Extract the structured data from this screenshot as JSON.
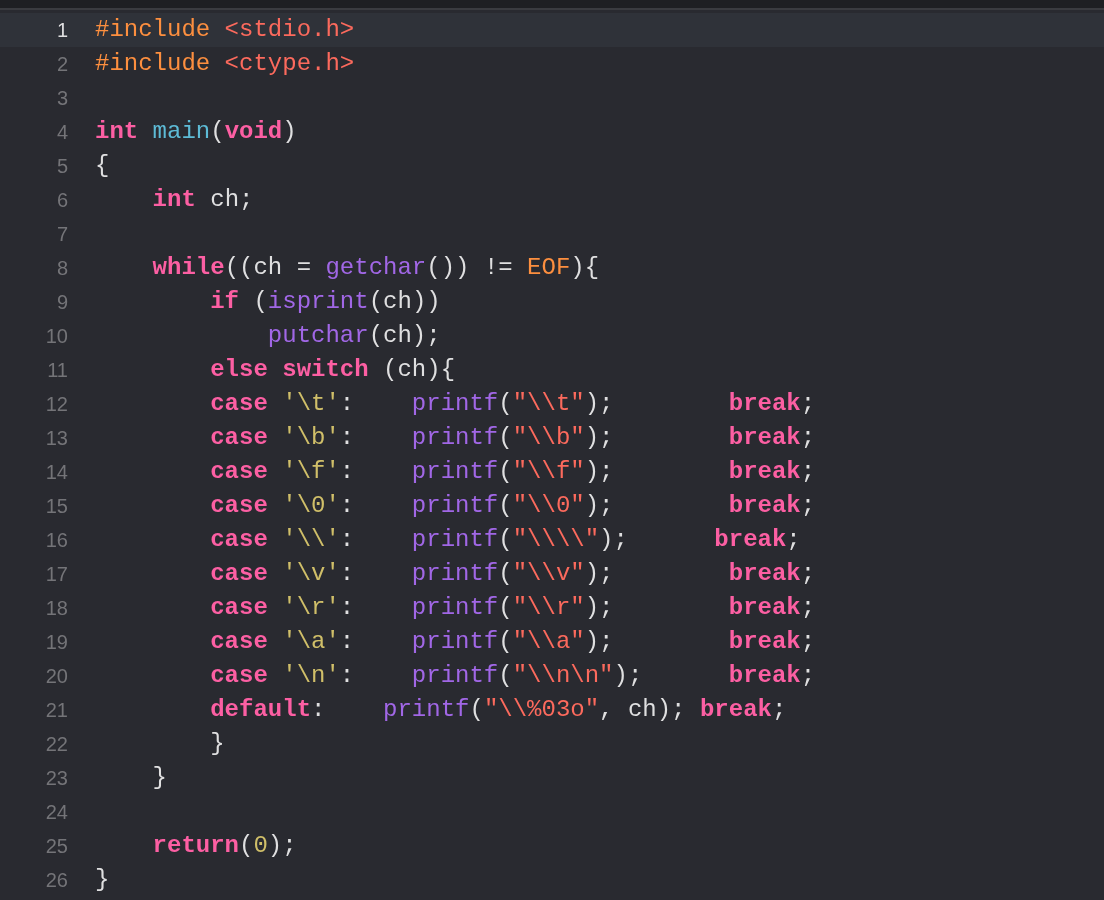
{
  "editor": {
    "lines": [
      {
        "number": "1",
        "current": true,
        "tokens": [
          {
            "text": "#include",
            "kind": "preprocessor"
          },
          {
            "text": " <stdio.h>",
            "kind": "string"
          }
        ]
      },
      {
        "number": "2",
        "current": false,
        "tokens": [
          {
            "text": "#include",
            "kind": "preprocessor"
          },
          {
            "text": " <ctype.h>",
            "kind": "string"
          }
        ]
      },
      {
        "number": "3",
        "current": false
      },
      {
        "number": "4",
        "current": false,
        "tokens": [
          {
            "text": "int",
            "kind": "keyword"
          },
          {
            "text": " main",
            "kind": "declaration"
          },
          {
            "text": "(",
            "kind": "plain"
          },
          {
            "text": "void",
            "kind": "keyword"
          },
          {
            "text": ")",
            "kind": "plain"
          }
        ]
      },
      {
        "number": "5",
        "current": false,
        "tokens": [
          {
            "text": "{",
            "kind": "plain"
          }
        ]
      },
      {
        "number": "6",
        "current": false,
        "tokens": [
          {
            "text": "    int",
            "kind": "keyword"
          },
          {
            "text": " ch;",
            "kind": "plain"
          }
        ]
      },
      {
        "number": "7",
        "current": false
      },
      {
        "number": "8",
        "current": false,
        "tokens": [
          {
            "text": "    while",
            "kind": "keyword"
          },
          {
            "text": "((ch = ",
            "kind": "plain"
          },
          {
            "text": "getchar",
            "kind": "function"
          },
          {
            "text": "()) != ",
            "kind": "plain"
          },
          {
            "text": "EOF",
            "kind": "macro"
          },
          {
            "text": "){",
            "kind": "plain"
          }
        ]
      },
      {
        "number": "9",
        "current": false,
        "tokens": [
          {
            "text": "        if",
            "kind": "keyword"
          },
          {
            "text": " (",
            "kind": "plain"
          },
          {
            "text": "isprint",
            "kind": "function"
          },
          {
            "text": "(ch))",
            "kind": "plain"
          }
        ]
      },
      {
        "number": "10",
        "current": false,
        "tokens": [
          {
            "text": "            putchar",
            "kind": "function"
          },
          {
            "text": "(ch);",
            "kind": "plain"
          }
        ]
      },
      {
        "number": "11",
        "current": false,
        "tokens": [
          {
            "text": "        else",
            "kind": "keyword"
          },
          {
            "text": " switch",
            "kind": "keyword"
          },
          {
            "text": " (ch){",
            "kind": "plain"
          }
        ]
      },
      {
        "number": "12",
        "current": false,
        "tokens": [
          {
            "text": "        case",
            "kind": "keyword"
          },
          {
            "text": " '\\t'",
            "kind": "char"
          },
          {
            "text": ":    ",
            "kind": "plain"
          },
          {
            "text": "printf",
            "kind": "function"
          },
          {
            "text": "(",
            "kind": "plain"
          },
          {
            "text": "\"\\\\t\"",
            "kind": "string"
          },
          {
            "text": ");        ",
            "kind": "plain"
          },
          {
            "text": "break",
            "kind": "keyword"
          },
          {
            "text": ";",
            "kind": "plain"
          }
        ]
      },
      {
        "number": "13",
        "current": false,
        "tokens": [
          {
            "text": "        case",
            "kind": "keyword"
          },
          {
            "text": " '\\b'",
            "kind": "char"
          },
          {
            "text": ":    ",
            "kind": "plain"
          },
          {
            "text": "printf",
            "kind": "function"
          },
          {
            "text": "(",
            "kind": "plain"
          },
          {
            "text": "\"\\\\b\"",
            "kind": "string"
          },
          {
            "text": ");        ",
            "kind": "plain"
          },
          {
            "text": "break",
            "kind": "keyword"
          },
          {
            "text": ";",
            "kind": "plain"
          }
        ]
      },
      {
        "number": "14",
        "current": false,
        "tokens": [
          {
            "text": "        case",
            "kind": "keyword"
          },
          {
            "text": " '\\f'",
            "kind": "char"
          },
          {
            "text": ":    ",
            "kind": "plain"
          },
          {
            "text": "printf",
            "kind": "function"
          },
          {
            "text": "(",
            "kind": "plain"
          },
          {
            "text": "\"\\\\f\"",
            "kind": "string"
          },
          {
            "text": ");        ",
            "kind": "plain"
          },
          {
            "text": "break",
            "kind": "keyword"
          },
          {
            "text": ";",
            "kind": "plain"
          }
        ]
      },
      {
        "number": "15",
        "current": false,
        "tokens": [
          {
            "text": "        case",
            "kind": "keyword"
          },
          {
            "text": " '\\0'",
            "kind": "char"
          },
          {
            "text": ":    ",
            "kind": "plain"
          },
          {
            "text": "printf",
            "kind": "function"
          },
          {
            "text": "(",
            "kind": "plain"
          },
          {
            "text": "\"\\\\0\"",
            "kind": "string"
          },
          {
            "text": ");        ",
            "kind": "plain"
          },
          {
            "text": "break",
            "kind": "keyword"
          },
          {
            "text": ";",
            "kind": "plain"
          }
        ]
      },
      {
        "number": "16",
        "current": false,
        "tokens": [
          {
            "text": "        case",
            "kind": "keyword"
          },
          {
            "text": " '\\\\'",
            "kind": "char"
          },
          {
            "text": ":    ",
            "kind": "plain"
          },
          {
            "text": "printf",
            "kind": "function"
          },
          {
            "text": "(",
            "kind": "plain"
          },
          {
            "text": "\"\\\\\\\\\"",
            "kind": "string"
          },
          {
            "text": ");      ",
            "kind": "plain"
          },
          {
            "text": "break",
            "kind": "keyword"
          },
          {
            "text": ";",
            "kind": "plain"
          }
        ]
      },
      {
        "number": "17",
        "current": false,
        "tokens": [
          {
            "text": "        case",
            "kind": "keyword"
          },
          {
            "text": " '\\v'",
            "kind": "char"
          },
          {
            "text": ":    ",
            "kind": "plain"
          },
          {
            "text": "printf",
            "kind": "function"
          },
          {
            "text": "(",
            "kind": "plain"
          },
          {
            "text": "\"\\\\v\"",
            "kind": "string"
          },
          {
            "text": ");        ",
            "kind": "plain"
          },
          {
            "text": "break",
            "kind": "keyword"
          },
          {
            "text": ";",
            "kind": "plain"
          }
        ]
      },
      {
        "number": "18",
        "current": false,
        "tokens": [
          {
            "text": "        case",
            "kind": "keyword"
          },
          {
            "text": " '\\r'",
            "kind": "char"
          },
          {
            "text": ":    ",
            "kind": "plain"
          },
          {
            "text": "printf",
            "kind": "function"
          },
          {
            "text": "(",
            "kind": "plain"
          },
          {
            "text": "\"\\\\r\"",
            "kind": "string"
          },
          {
            "text": ");        ",
            "kind": "plain"
          },
          {
            "text": "break",
            "kind": "keyword"
          },
          {
            "text": ";",
            "kind": "plain"
          }
        ]
      },
      {
        "number": "19",
        "current": false,
        "tokens": [
          {
            "text": "        case",
            "kind": "keyword"
          },
          {
            "text": " '\\a'",
            "kind": "char"
          },
          {
            "text": ":    ",
            "kind": "plain"
          },
          {
            "text": "printf",
            "kind": "function"
          },
          {
            "text": "(",
            "kind": "plain"
          },
          {
            "text": "\"\\\\a\"",
            "kind": "string"
          },
          {
            "text": ");        ",
            "kind": "plain"
          },
          {
            "text": "break",
            "kind": "keyword"
          },
          {
            "text": ";",
            "kind": "plain"
          }
        ]
      },
      {
        "number": "20",
        "current": false,
        "tokens": [
          {
            "text": "        case",
            "kind": "keyword"
          },
          {
            "text": " '\\n'",
            "kind": "char"
          },
          {
            "text": ":    ",
            "kind": "plain"
          },
          {
            "text": "printf",
            "kind": "function"
          },
          {
            "text": "(",
            "kind": "plain"
          },
          {
            "text": "\"\\\\n\\n\"",
            "kind": "string"
          },
          {
            "text": ");      ",
            "kind": "plain"
          },
          {
            "text": "break",
            "kind": "keyword"
          },
          {
            "text": ";",
            "kind": "plain"
          }
        ]
      },
      {
        "number": "21",
        "current": false,
        "tokens": [
          {
            "text": "        default",
            "kind": "keyword"
          },
          {
            "text": ":    ",
            "kind": "plain"
          },
          {
            "text": "printf",
            "kind": "function"
          },
          {
            "text": "(",
            "kind": "plain"
          },
          {
            "text": "\"\\\\%03o\"",
            "kind": "string"
          },
          {
            "text": ", ch); ",
            "kind": "plain"
          },
          {
            "text": "break",
            "kind": "keyword"
          },
          {
            "text": ";",
            "kind": "plain"
          }
        ]
      },
      {
        "number": "22",
        "current": false,
        "tokens": [
          {
            "text": "        }",
            "kind": "plain"
          }
        ]
      },
      {
        "number": "23",
        "current": false,
        "tokens": [
          {
            "text": "    }",
            "kind": "plain"
          }
        ]
      },
      {
        "number": "24",
        "current": false
      },
      {
        "number": "25",
        "current": false,
        "tokens": [
          {
            "text": "    return",
            "kind": "keyword"
          },
          {
            "text": "(",
            "kind": "plain"
          },
          {
            "text": "0",
            "kind": "number"
          },
          {
            "text": ");",
            "kind": "plain"
          }
        ]
      },
      {
        "number": "26",
        "current": false,
        "tokens": [
          {
            "text": "}",
            "kind": "plain"
          }
        ]
      }
    ]
  }
}
